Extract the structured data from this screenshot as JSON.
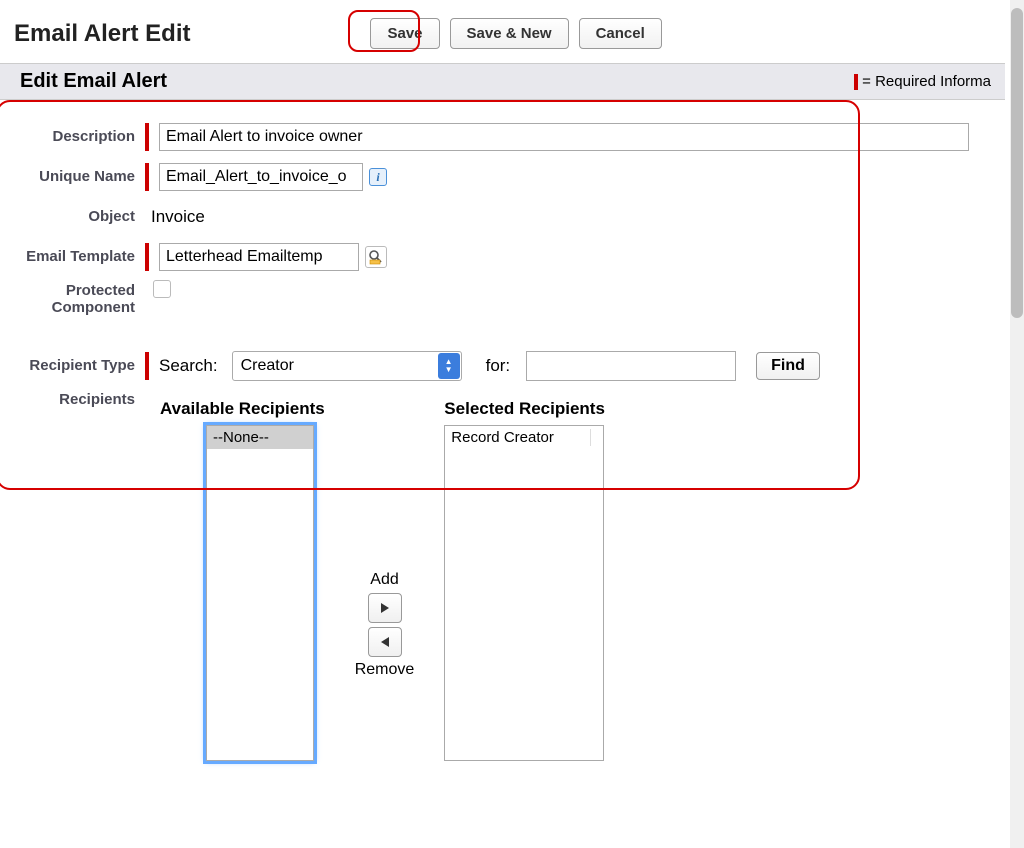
{
  "header": {
    "title": "Email Alert Edit",
    "buttons": {
      "save": "Save",
      "save_new": "Save & New",
      "cancel": "Cancel"
    }
  },
  "section": {
    "title": "Edit Email Alert",
    "required_text": "= Required Informa"
  },
  "form": {
    "labels": {
      "description": "Description",
      "unique_name": "Unique Name",
      "object": "Object",
      "email_template": "Email Template",
      "protected": "Protected Component",
      "recipient_type": "Recipient Type",
      "recipients": "Recipients"
    },
    "values": {
      "description": "Email Alert to invoice owner",
      "unique_name": "Email_Alert_to_invoice_o",
      "object": "Invoice",
      "email_template": "Letterhead Emailtemp",
      "protected_checked": false
    },
    "search": {
      "label": "Search:",
      "selected": "Creator",
      "for_label": "for:",
      "for_value": "",
      "find": "Find"
    },
    "dual_list": {
      "available_title": "Available Recipients",
      "selected_title": "Selected Recipients",
      "available": [
        "--None--"
      ],
      "selected": [
        "Record Creator"
      ],
      "add_label": "Add",
      "remove_label": "Remove"
    }
  }
}
